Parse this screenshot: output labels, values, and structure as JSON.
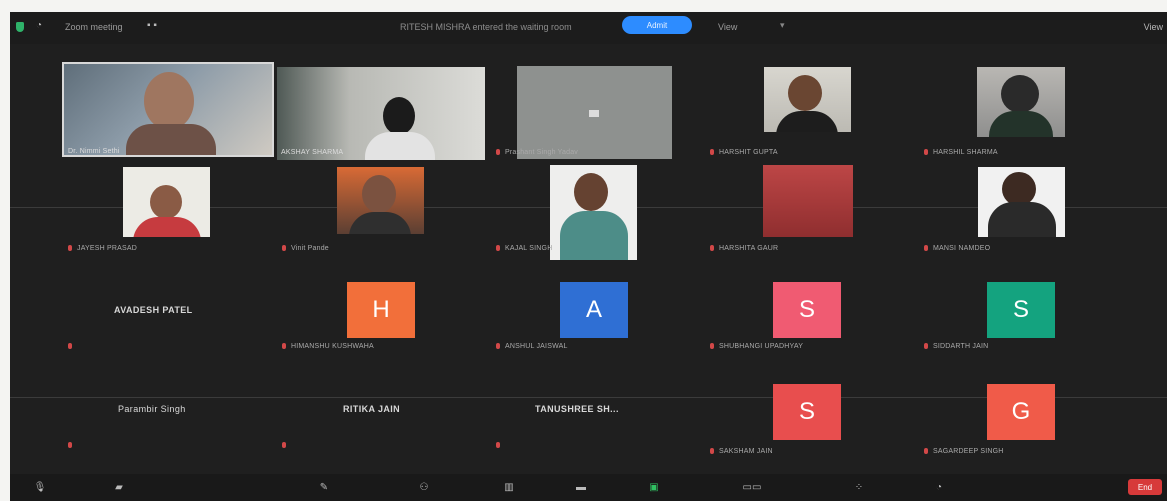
{
  "topbar": {
    "meeting_title": "Zoom meeting",
    "notice": "RITESH MISHRA entered the waiting room",
    "admit_label": "Admit",
    "view_label": "View",
    "view_mode": "View"
  },
  "participants": [
    {
      "name": "Dr. Nimmi Sethi",
      "kind": "video"
    },
    {
      "name": "AKSHAY SHARMA",
      "kind": "video"
    },
    {
      "name": "Prashant Singh Yadav",
      "kind": "video"
    },
    {
      "name": "HARSHIT GUPTA",
      "kind": "video"
    },
    {
      "name": "HARSHIL SHARMA",
      "kind": "video"
    },
    {
      "name": "JAYESH PRASAD",
      "kind": "video"
    },
    {
      "name": "Vinit Pande",
      "kind": "video"
    },
    {
      "name": "KAJAL SINGH",
      "kind": "video"
    },
    {
      "name": "HARSHITA GAUR",
      "kind": "video"
    },
    {
      "name": "MANSI NAMDEO",
      "kind": "video"
    },
    {
      "name": "AVADESH PATEL",
      "kind": "name"
    },
    {
      "name": "HIMANSHU KUSHWAHA",
      "kind": "avatar",
      "initial": "H",
      "color": "#f26f3a"
    },
    {
      "name": "ANSHUL JAISWAL",
      "kind": "avatar",
      "initial": "A",
      "color": "#2f6fd4"
    },
    {
      "name": "SHUBHANGI UPADHYAY",
      "kind": "avatar",
      "initial": "S",
      "color": "#f05b72"
    },
    {
      "name": "SIDDARTH JAIN",
      "kind": "avatar",
      "initial": "S",
      "color": "#14a37f"
    },
    {
      "name": "Parambir Singh",
      "kind": "name"
    },
    {
      "name": "RITIKA JAIN",
      "kind": "name"
    },
    {
      "name": "TANUSHREE SH...",
      "kind": "name"
    },
    {
      "name": "SAKSHAM JAIN",
      "kind": "avatar",
      "initial": "S",
      "color": "#e84e4e"
    },
    {
      "name": "SAGARDEEP SINGH",
      "kind": "avatar",
      "initial": "G",
      "color": "#f05b49"
    }
  ],
  "toolbar": {
    "end_label": "End"
  }
}
